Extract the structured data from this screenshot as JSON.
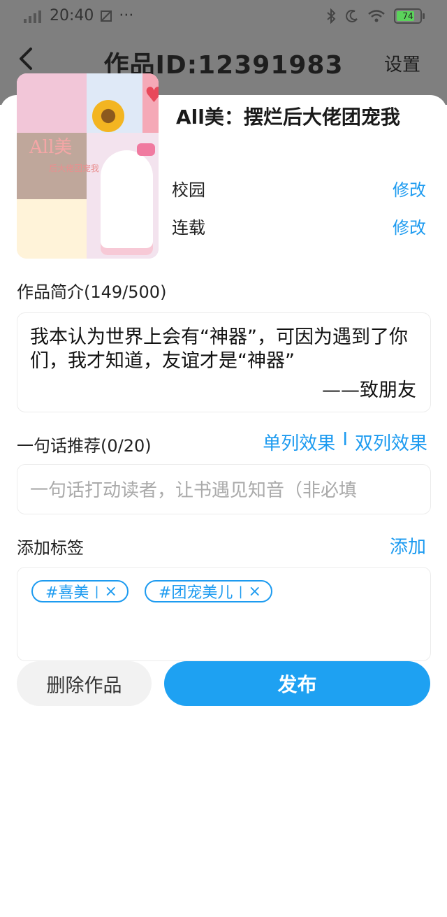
{
  "status_bar": {
    "time": "20:40",
    "more": "···",
    "battery": "74",
    "icons": [
      "signal-icon",
      "screenshot-icon",
      "bluetooth-icon",
      "moon-icon",
      "wifi-icon",
      "battery-icon"
    ]
  },
  "header": {
    "title": "作品ID:12391983",
    "settings_label": "设置",
    "back_icon": "chevron-left-icon"
  },
  "cover": {
    "title_text": "All美",
    "subtitle_text": "后大佬团宠我"
  },
  "work": {
    "title": "All美：摆烂后大佬团宠我",
    "category": {
      "label": "校园",
      "action": "修改"
    },
    "status": {
      "label": "连载",
      "action": "修改"
    }
  },
  "intro": {
    "label": "作品简介(149/500)",
    "text": "我本认为世界上会有“神器”，可因为遇到了你们，我才知道，友谊才是“神器”",
    "signature": "——致朋友"
  },
  "slogan": {
    "label": "一句话推荐(0/20)",
    "placeholder": "一句话打动读者，让书遇见知音（非必填",
    "mode_single": "单列效果",
    "mode_sep": "I",
    "mode_double": "双列效果"
  },
  "tags": {
    "label": "添加标签",
    "add_label": "添加",
    "items": [
      {
        "text": "#喜美",
        "sep": "|",
        "remove": "×"
      },
      {
        "text": "#团宠美儿",
        "sep": "|",
        "remove": "×"
      }
    ]
  },
  "actions": {
    "delete_label": "删除作品",
    "publish_label": "发布"
  },
  "colors": {
    "accent": "#1d9bf0",
    "primary_button": "#1ea1f2",
    "overlay": "#7f7f7f"
  }
}
